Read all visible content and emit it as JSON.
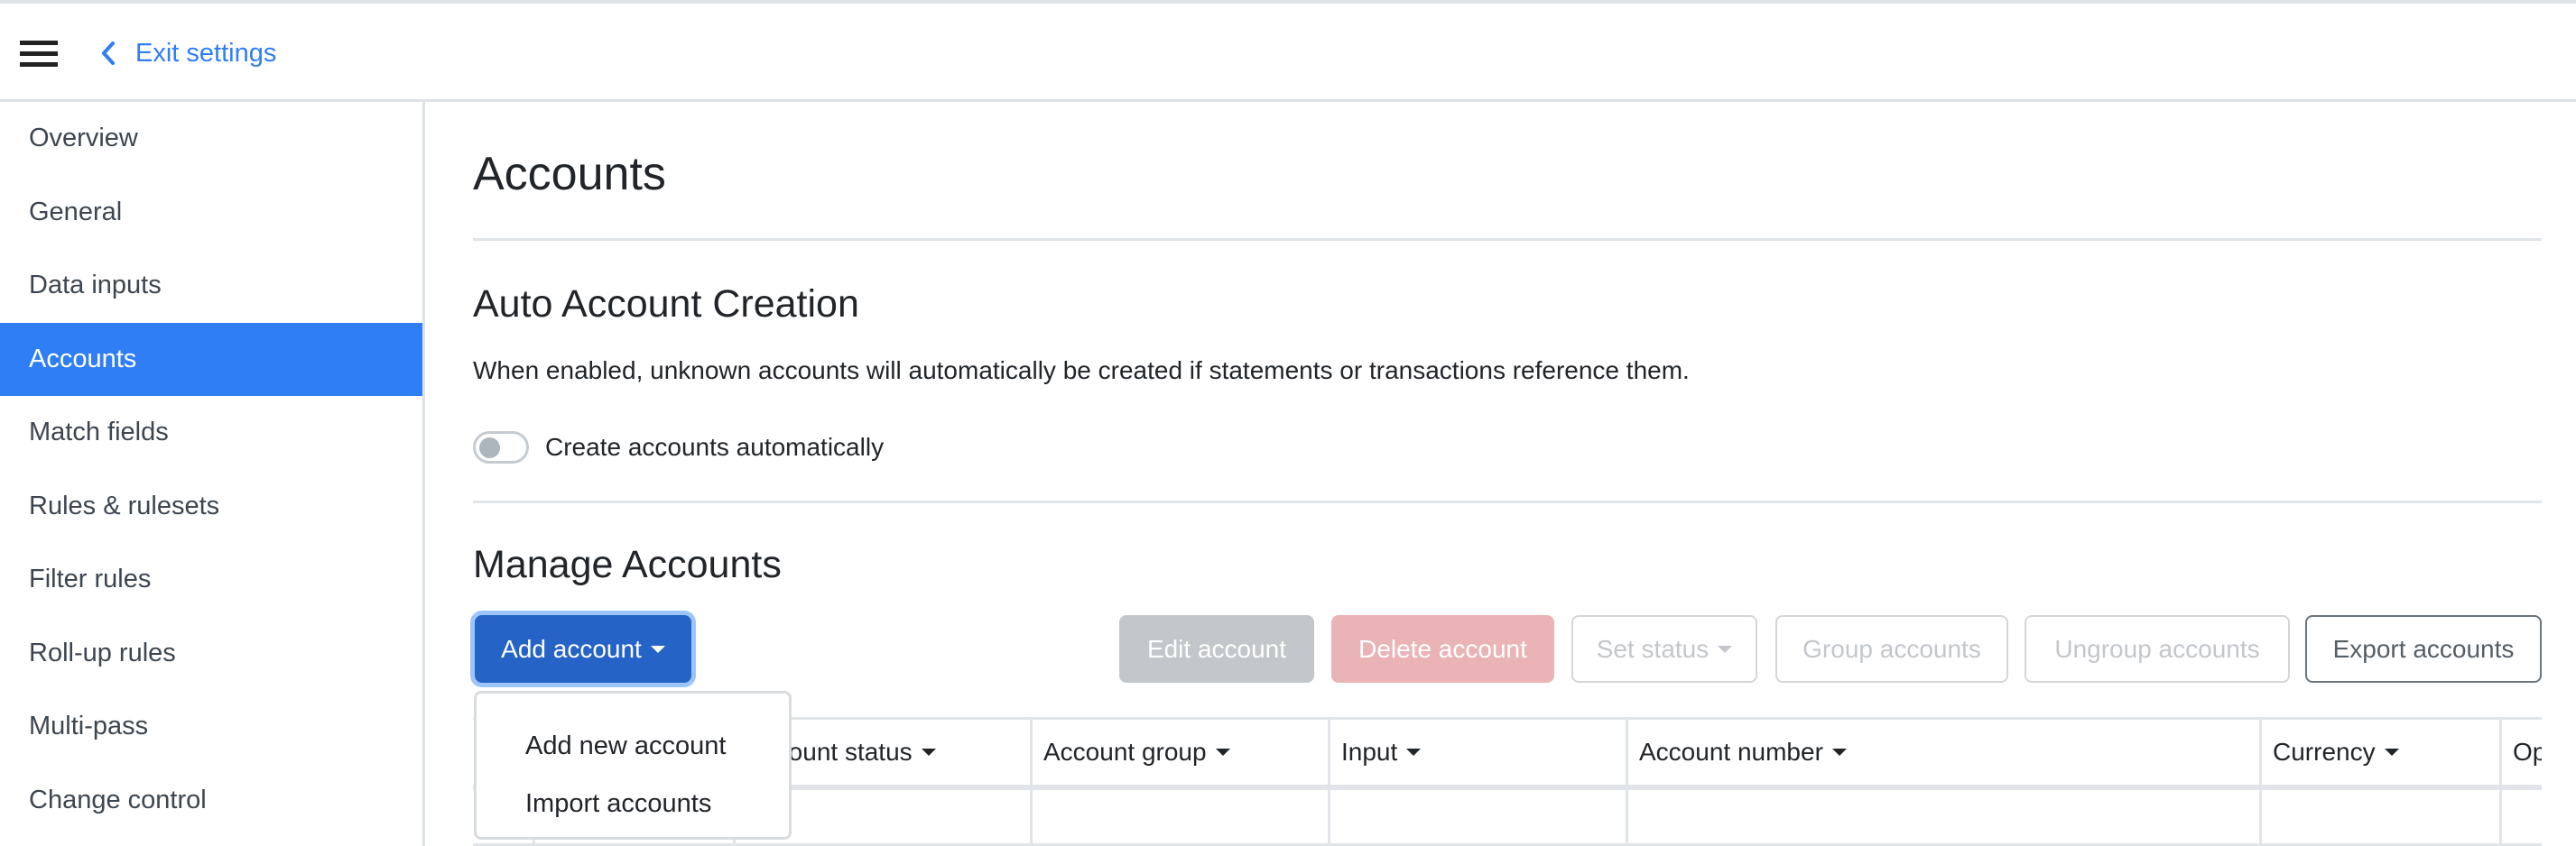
{
  "header": {
    "menu_icon": "hamburger-icon",
    "exit_label": "Exit settings",
    "exit_icon": "chevron-left-icon"
  },
  "sidebar": {
    "items": [
      {
        "label": "Overview",
        "active": false
      },
      {
        "label": "General",
        "active": false
      },
      {
        "label": "Data inputs",
        "active": false
      },
      {
        "label": "Accounts",
        "active": true
      },
      {
        "label": "Match fields",
        "active": false
      },
      {
        "label": "Rules & rulesets",
        "active": false
      },
      {
        "label": "Filter rules",
        "active": false
      },
      {
        "label": "Roll-up rules",
        "active": false
      },
      {
        "label": "Multi-pass",
        "active": false
      },
      {
        "label": "Change control",
        "active": false
      }
    ]
  },
  "main": {
    "title": "Accounts",
    "auto_creation": {
      "heading": "Auto Account Creation",
      "description": "When enabled, unknown accounts will automatically be created if statements or transactions reference them.",
      "toggle_label": "Create accounts automatically",
      "toggle_on": false
    },
    "manage": {
      "heading": "Manage Accounts",
      "buttons": {
        "add": "Add account",
        "edit": "Edit account",
        "delete": "Delete account",
        "set_status": "Set status",
        "group": "Group accounts",
        "ungroup": "Ungroup accounts",
        "export": "Export accounts"
      },
      "add_menu": {
        "open": true,
        "items": [
          "Add new account",
          "Import accounts"
        ]
      },
      "table": {
        "columns": [
          "",
          "",
          "Account status",
          "Account group",
          "Input",
          "Account number",
          "Currency",
          "Op"
        ],
        "rows": [
          [
            "",
            "",
            "",
            "",
            "",
            "",
            "",
            ""
          ]
        ]
      }
    }
  },
  "colors": {
    "accent": "#2f7ef5",
    "primary_button": "#2563c6",
    "disabled_button": "#c3c7cb",
    "danger_disabled": "#eab4b7",
    "border": "#dee2e6"
  }
}
